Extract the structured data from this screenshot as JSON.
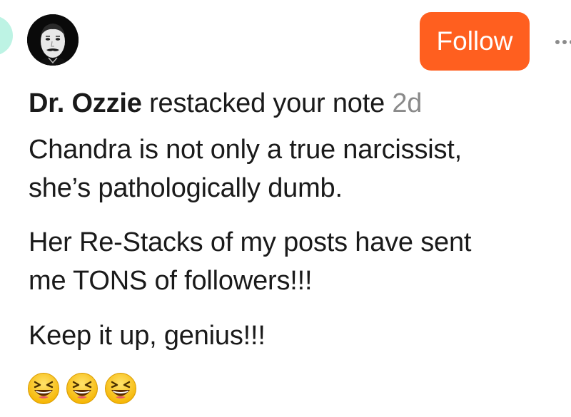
{
  "header": {
    "follow_label": "Follow",
    "more_icon": "ellipsis-icon"
  },
  "note": {
    "author": "Dr. Ozzie",
    "action": "restacked your note",
    "time": "2d",
    "paragraphs": [
      "Chandra is not only a true narcissist,\nshe’s pathologically dumb.",
      "Her Re-Stacks of my posts have sent\nme TONS of followers!!!",
      "Keep it up, genius!!!"
    ],
    "emojis": [
      "😆",
      "😆",
      "😆"
    ]
  },
  "colors": {
    "accent": "#ff5f1f",
    "timestamp": "#8a8a8a",
    "mint": "#bdf3e4"
  }
}
